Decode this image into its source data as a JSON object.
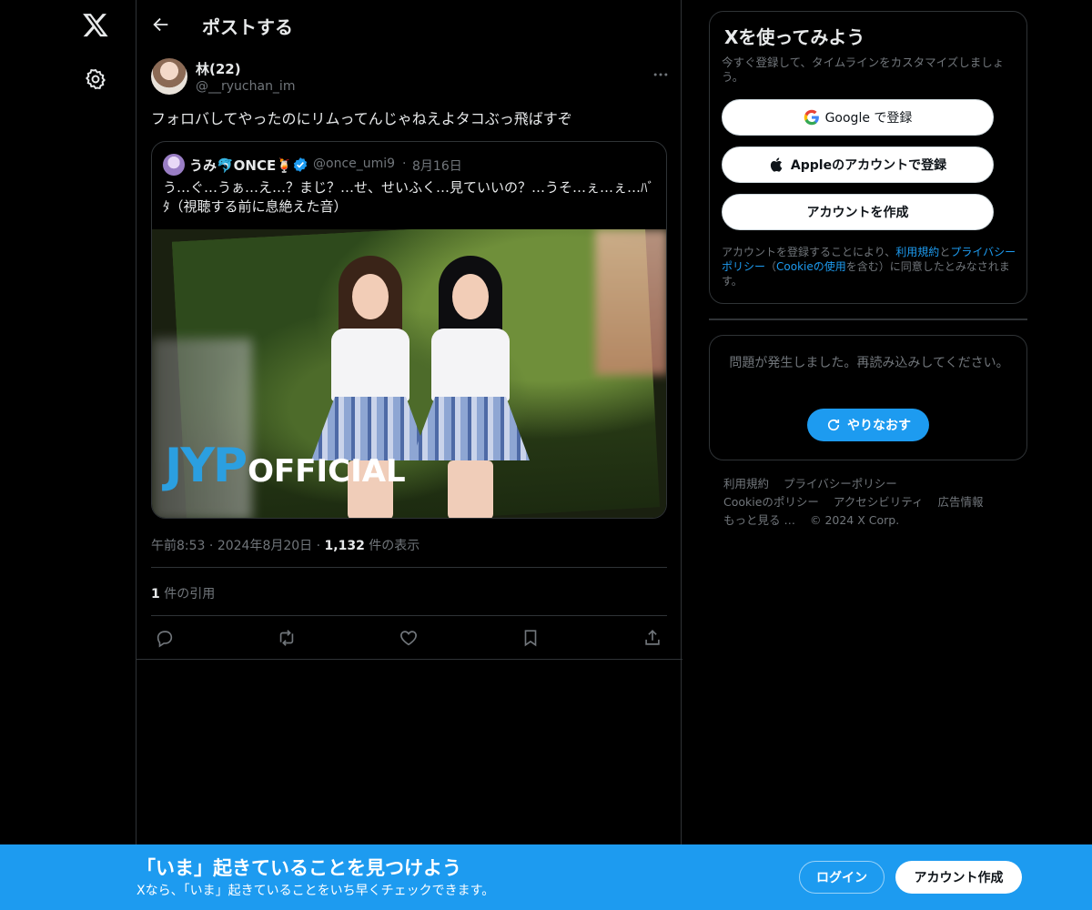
{
  "colors": {
    "accent": "#1d9bf0",
    "background": "#000000",
    "text": "#e7e9ea",
    "muted": "#71767b",
    "border": "#2f3336"
  },
  "nav": {
    "logo_icon": "x-logo-icon",
    "settings_icon": "gear-icon"
  },
  "header": {
    "title": "ポストする",
    "back_icon": "arrow-left-icon"
  },
  "tweet": {
    "author_name": "林(22)",
    "author_handle": "@__ryuchan_im",
    "text": "フォロバしてやったのにリムってんじゃねえよタコぶっ飛ばすぞ",
    "time": "午前8:53",
    "date": "2024年8月20日",
    "views_count": "1,132",
    "views_label": "件の表示",
    "quotes_count": "1",
    "quotes_label": "件の引用",
    "sep": "·"
  },
  "quoted": {
    "name": "うみ🐬ONCE🍹",
    "handle": "@once_umi9",
    "date": "8月16日",
    "text": "う…ぐ…うぁ…え…？まじ？…せ、せいふく…見ていいの？…うそ…ぇ…ぇ…ﾊﾞﾀ（視聴する前に息絶えた音）",
    "media_logo_jyp": "JYP",
    "media_logo_official": "OFFICIAL"
  },
  "signup": {
    "title": "Xを使ってみよう",
    "subtitle": "今すぐ登録して、タイムラインをカスタマイズしましょう。",
    "google_label": "Google で登録",
    "apple_label": "Appleのアカウントで登録",
    "create_label": "アカウントを作成",
    "legal_prefix": "アカウントを登録することにより、",
    "legal_terms": "利用規約",
    "legal_and": "と",
    "legal_privacy": "プライバシーポリシー",
    "legal_paren_open": "（",
    "legal_cookie": "Cookieの使用",
    "legal_paren_close": "を含む）に同意したとみなされます。"
  },
  "error_box": {
    "message": "問題が発生しました。再読み込みしてください。",
    "retry_label": "やりなおす"
  },
  "footer": {
    "links": [
      "利用規約",
      "プライバシーポリシー",
      "Cookieのポリシー",
      "アクセシビリティ",
      "広告情報",
      "もっと見る …",
      "© 2024 X Corp."
    ]
  },
  "banner": {
    "title": "「いま」起きていることを見つけよう",
    "subtitle": "Xなら、「いま」起きていることをいち早くチェックできます。",
    "login_label": "ログイン",
    "create_label": "アカウント作成"
  }
}
